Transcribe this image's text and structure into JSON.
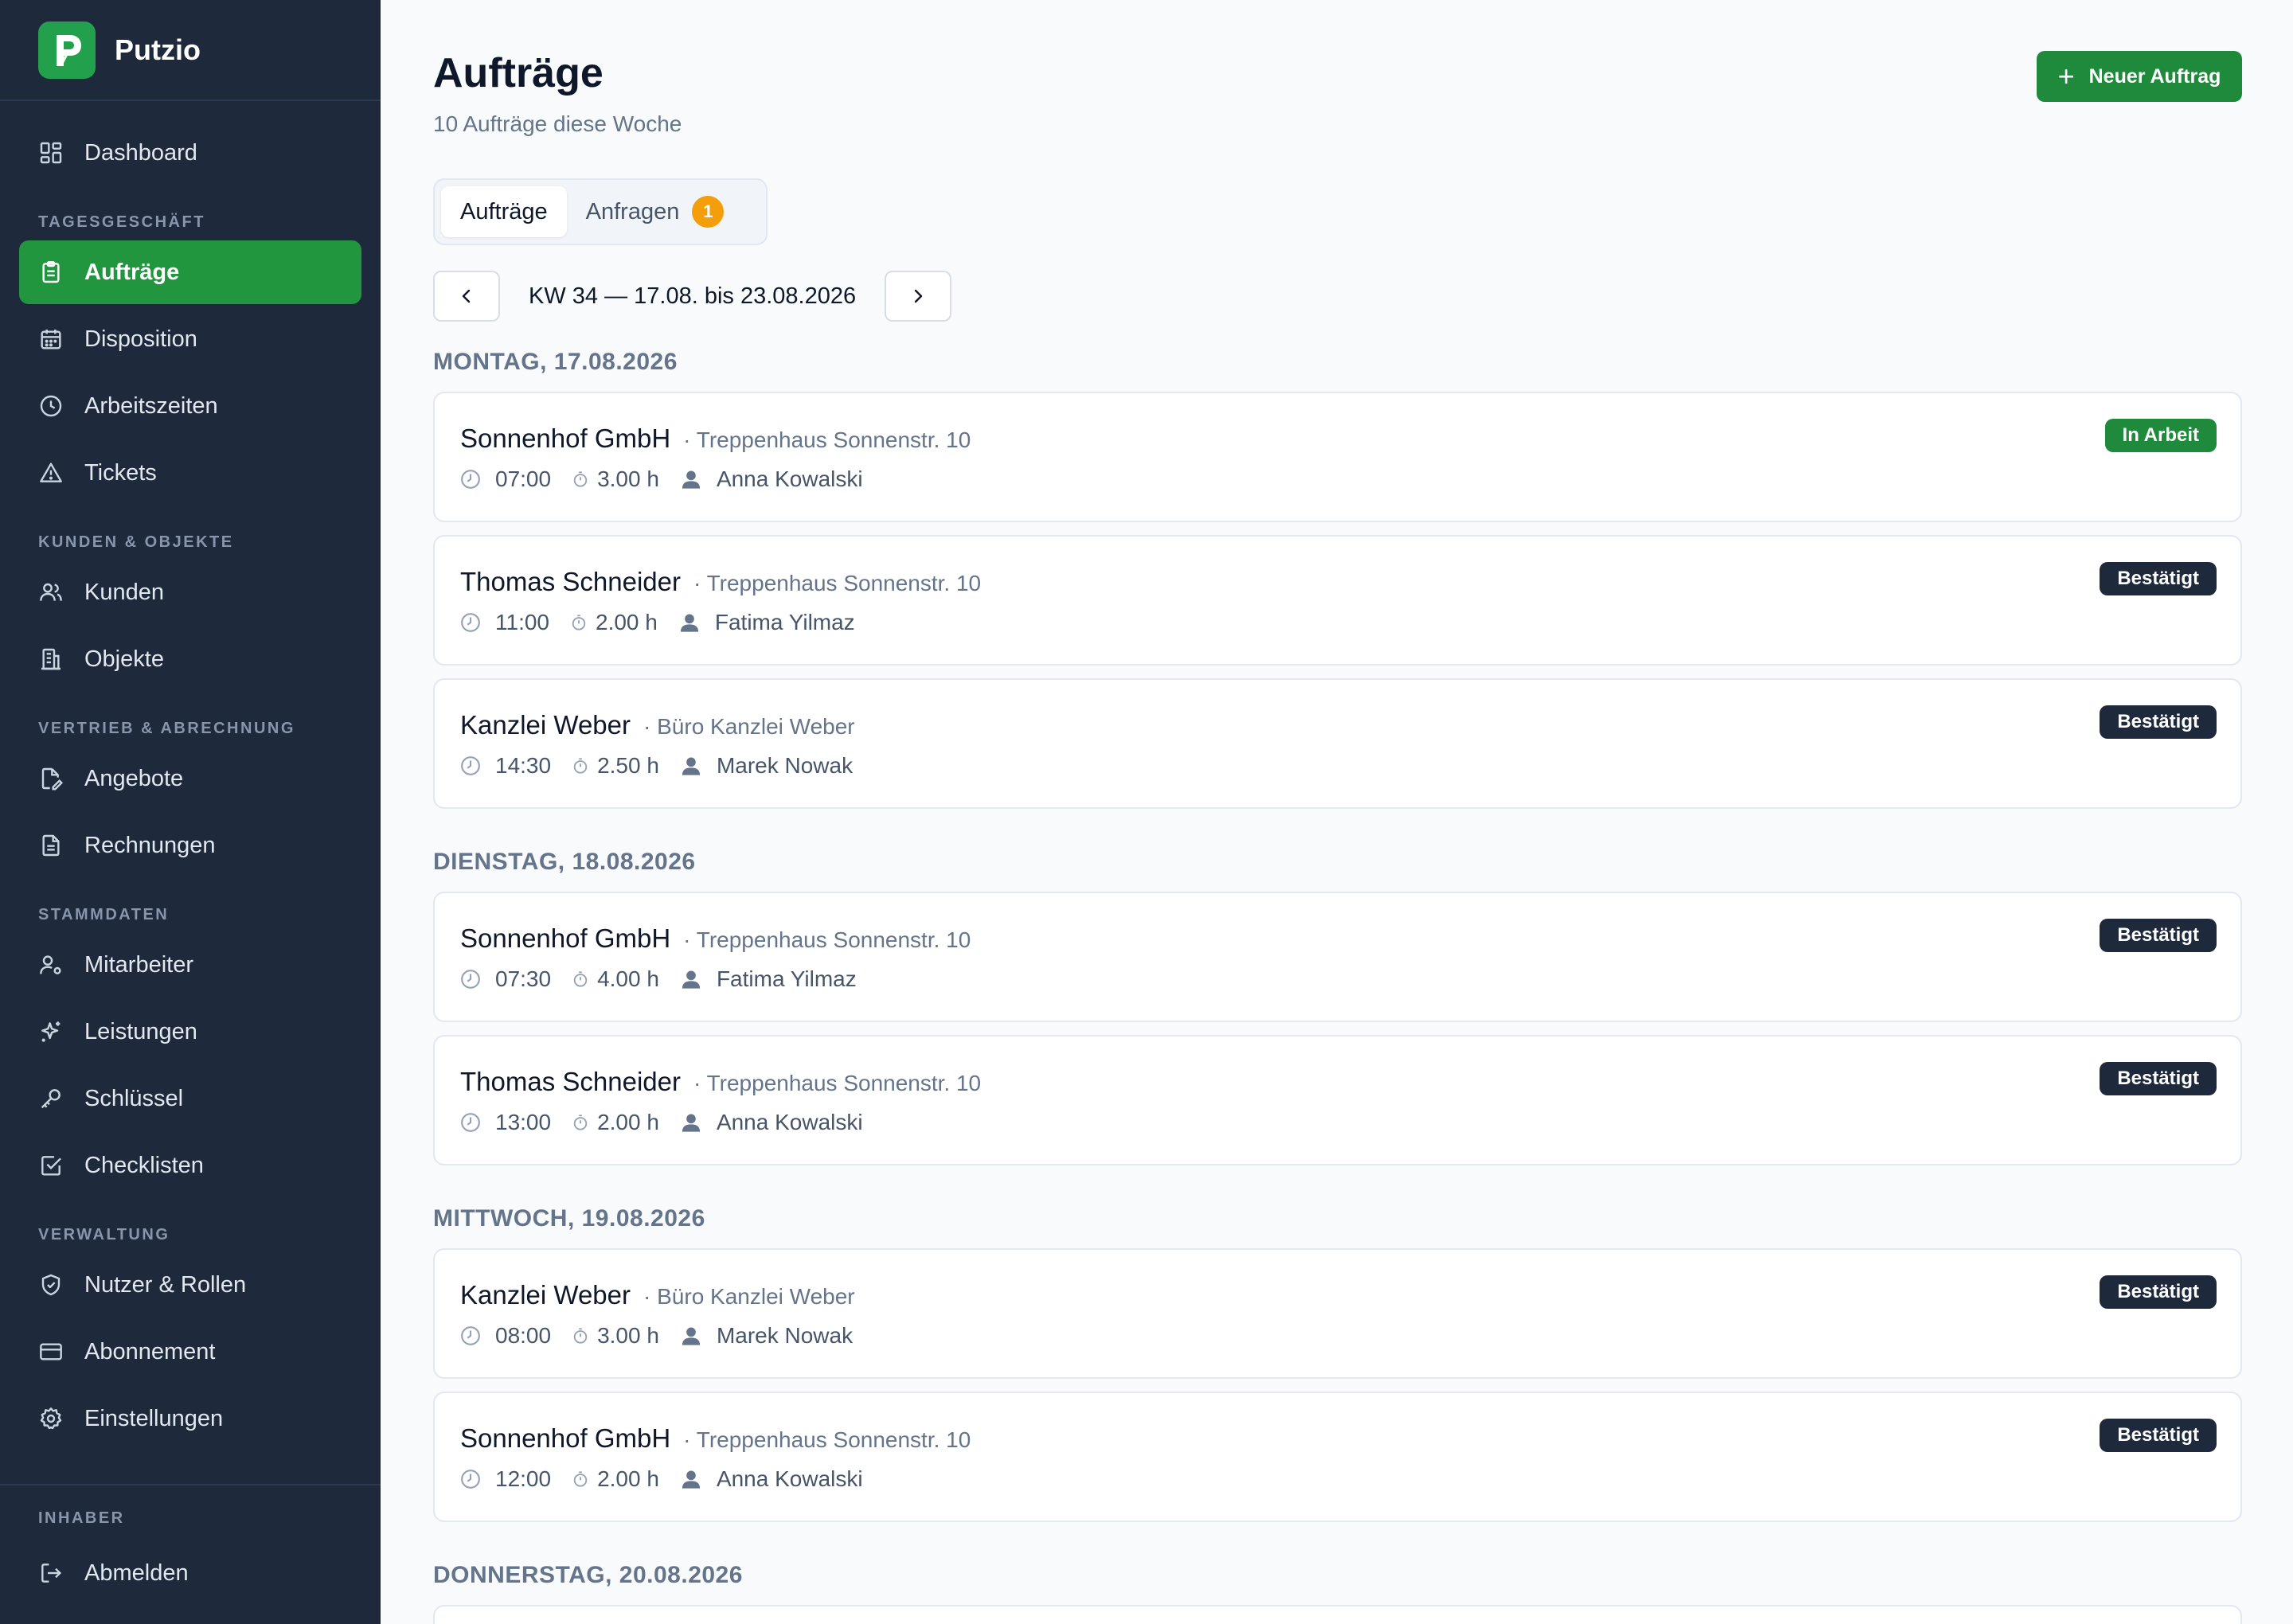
{
  "app": {
    "name": "Putzio"
  },
  "sidebar": {
    "dashboard": "Dashboard",
    "sections": {
      "tagesgeschaeft": "TAGESGESCHÄFT",
      "kunden_objekte": "KUNDEN & OBJEKTE",
      "vertrieb": "VERTRIEB & ABRECHNUNG",
      "stammdaten": "STAMMDATEN",
      "verwaltung": "VERWALTUNG",
      "inhaber": "INHABER"
    },
    "items": {
      "auftraege": "Aufträge",
      "disposition": "Disposition",
      "arbeitszeiten": "Arbeitszeiten",
      "tickets": "Tickets",
      "kunden": "Kunden",
      "objekte": "Objekte",
      "angebote": "Angebote",
      "rechnungen": "Rechnungen",
      "mitarbeiter": "Mitarbeiter",
      "leistungen": "Leistungen",
      "schluessel": "Schlüssel",
      "checklisten": "Checklisten",
      "nutzer_rollen": "Nutzer & Rollen",
      "abonnement": "Abonnement",
      "einstellungen": "Einstellungen",
      "abmelden": "Abmelden"
    },
    "active_item": "auftraege"
  },
  "header": {
    "title": "Aufträge",
    "subtitle": "10 Aufträge diese Woche",
    "new_button_label": "Neuer Auftrag"
  },
  "tabs": {
    "auftraege": "Aufträge",
    "anfragen": "Anfragen",
    "anfragen_badge": "1",
    "active": "auftraege"
  },
  "week": {
    "label": "KW 34 — 17.08. bis 23.08.2026"
  },
  "days": [
    {
      "heading": "MONTAG, 17.08.2026",
      "orders": [
        {
          "customer": "Sonnenhof GmbH",
          "object": "· Treppenhaus Sonnenstr. 10",
          "time": "07:00",
          "duration": "3.00 h",
          "employee": "Anna Kowalski",
          "status": "In Arbeit"
        },
        {
          "customer": "Thomas Schneider",
          "object": "· Treppenhaus Sonnenstr. 10",
          "time": "11:00",
          "duration": "2.00 h",
          "employee": "Fatima Yilmaz",
          "status": "Bestätigt"
        },
        {
          "customer": "Kanzlei Weber",
          "object": "· Büro Kanzlei Weber",
          "time": "14:30",
          "duration": "2.50 h",
          "employee": "Marek Nowak",
          "status": "Bestätigt"
        }
      ]
    },
    {
      "heading": "DIENSTAG, 18.08.2026",
      "orders": [
        {
          "customer": "Sonnenhof GmbH",
          "object": "· Treppenhaus Sonnenstr. 10",
          "time": "07:30",
          "duration": "4.00 h",
          "employee": "Fatima Yilmaz",
          "status": "Bestätigt"
        },
        {
          "customer": "Thomas Schneider",
          "object": "· Treppenhaus Sonnenstr. 10",
          "time": "13:00",
          "duration": "2.00 h",
          "employee": "Anna Kowalski",
          "status": "Bestätigt"
        }
      ]
    },
    {
      "heading": "MITTWOCH, 19.08.2026",
      "orders": [
        {
          "customer": "Kanzlei Weber",
          "object": "· Büro Kanzlei Weber",
          "time": "08:00",
          "duration": "3.00 h",
          "employee": "Marek Nowak",
          "status": "Bestätigt"
        },
        {
          "customer": "Sonnenhof GmbH",
          "object": "· Treppenhaus Sonnenstr. 10",
          "time": "12:00",
          "duration": "2.00 h",
          "employee": "Anna Kowalski",
          "status": "Bestätigt"
        }
      ]
    },
    {
      "heading": "DONNERSTAG, 20.08.2026",
      "orders": []
    }
  ],
  "colors": {
    "sidebar_bg": "#1e293b",
    "accent_green": "#1f8a3c",
    "badge_orange": "#f59e0b",
    "status_dark": "#1e293b"
  },
  "icons": {
    "dashboard": "grid-icon",
    "auftraege": "clipboard-icon",
    "disposition": "calendar-icon",
    "arbeitszeiten": "clock-icon",
    "tickets": "warning-icon",
    "kunden": "users-icon",
    "objekte": "building-icon",
    "angebote": "edit-document-icon",
    "rechnungen": "document-icon",
    "mitarbeiter": "user-cog-icon",
    "leistungen": "sparkle-icon",
    "schluessel": "key-icon",
    "checklisten": "checkbox-icon",
    "nutzer_rollen": "shield-icon",
    "abonnement": "credit-card-icon",
    "einstellungen": "gear-icon",
    "abmelden": "logout-icon"
  }
}
